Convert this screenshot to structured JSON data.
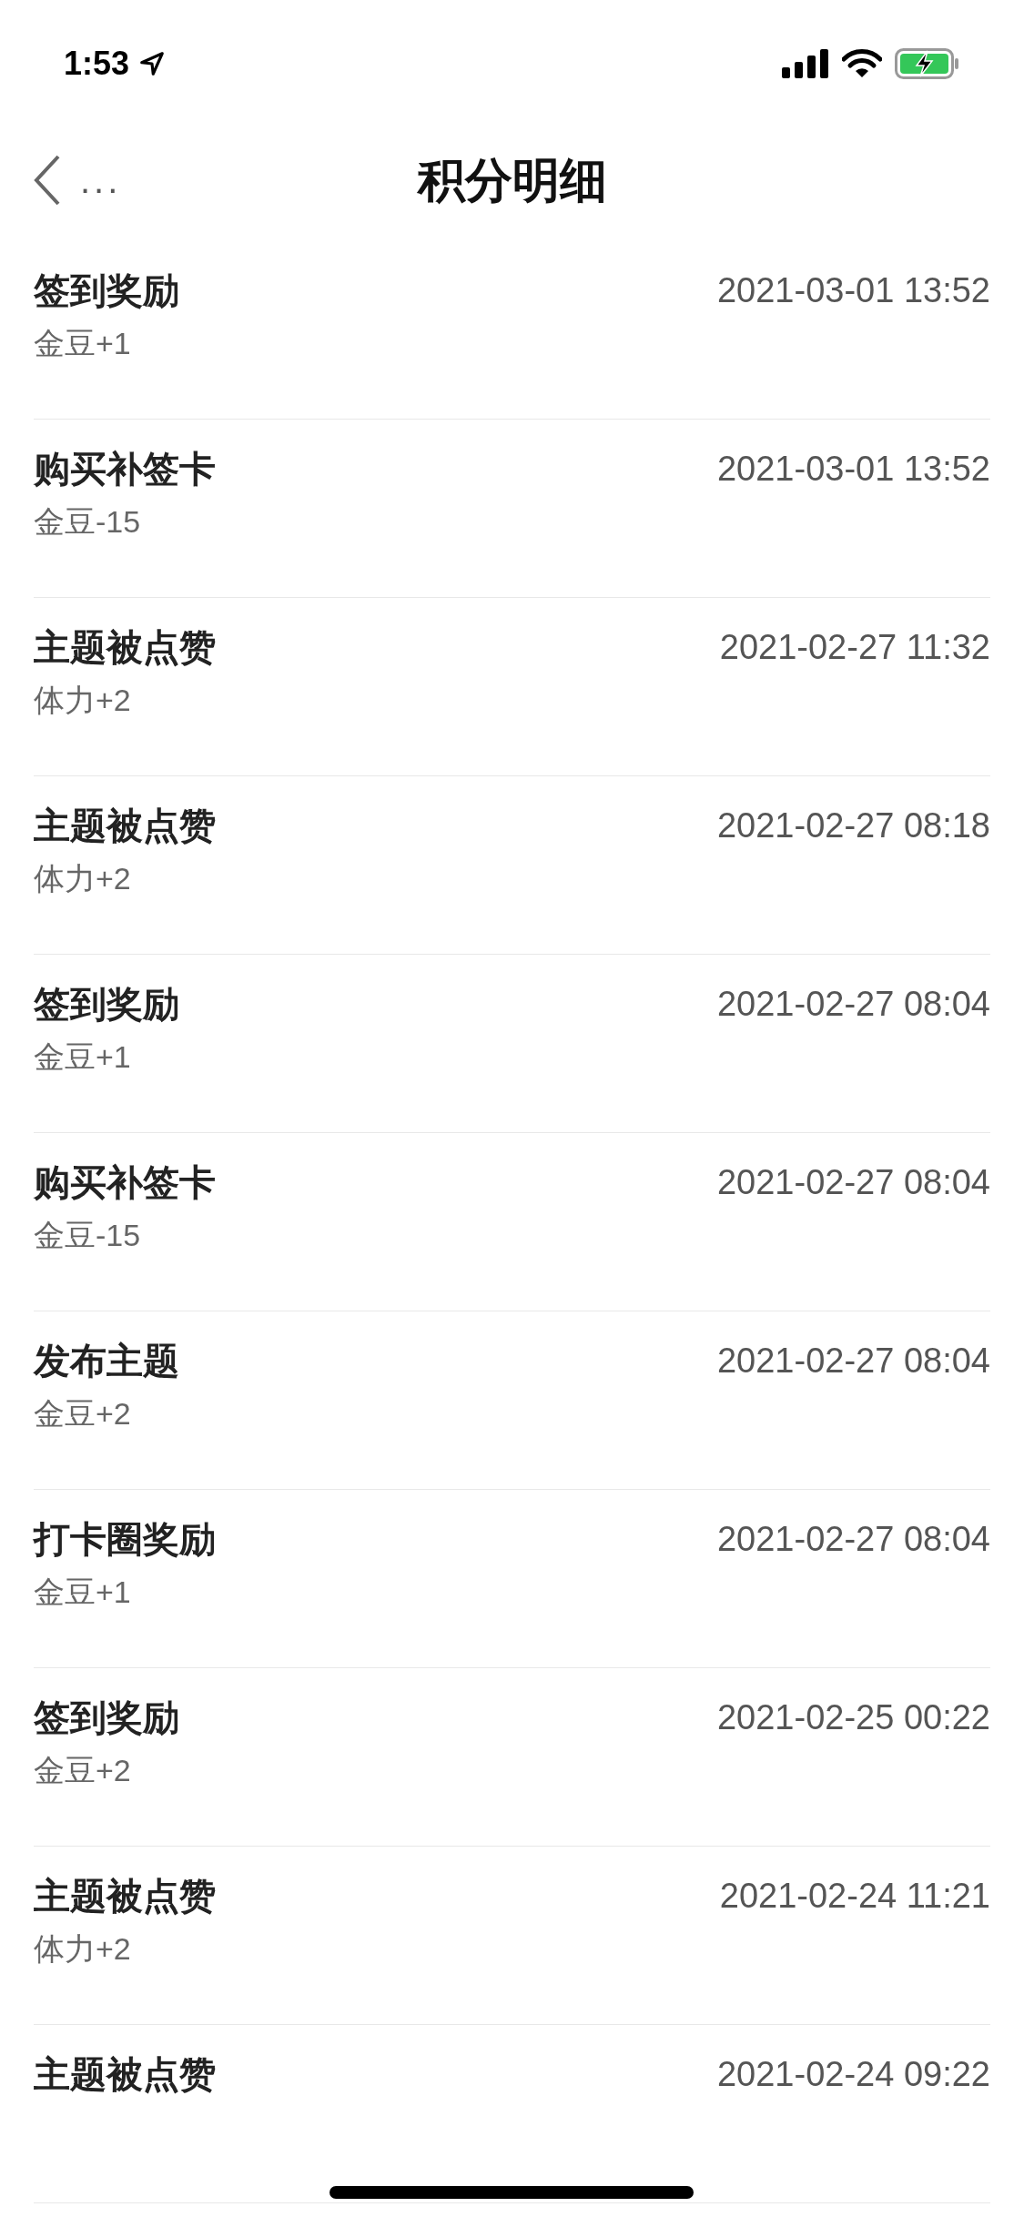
{
  "status_bar": {
    "time": "1:53"
  },
  "nav": {
    "title": "积分明细",
    "more": "..."
  },
  "records": [
    {
      "title": "签到奖励",
      "change": "金豆+1",
      "time": "2021-03-01 13:52"
    },
    {
      "title": "购买补签卡",
      "change": "金豆-15",
      "time": "2021-03-01 13:52"
    },
    {
      "title": "主题被点赞",
      "change": "体力+2",
      "time": "2021-02-27 11:32"
    },
    {
      "title": "主题被点赞",
      "change": "体力+2",
      "time": "2021-02-27 08:18"
    },
    {
      "title": "签到奖励",
      "change": "金豆+1",
      "time": "2021-02-27 08:04"
    },
    {
      "title": "购买补签卡",
      "change": "金豆-15",
      "time": "2021-02-27 08:04"
    },
    {
      "title": "发布主题",
      "change": "金豆+2",
      "time": "2021-02-27 08:04"
    },
    {
      "title": "打卡圈奖励",
      "change": "金豆+1",
      "time": "2021-02-27 08:04"
    },
    {
      "title": "签到奖励",
      "change": "金豆+2",
      "time": "2021-02-25 00:22"
    },
    {
      "title": "主题被点赞",
      "change": "体力+2",
      "time": "2021-02-24 11:21"
    },
    {
      "title": "主题被点赞",
      "time": "2021-02-24 09:22"
    }
  ]
}
